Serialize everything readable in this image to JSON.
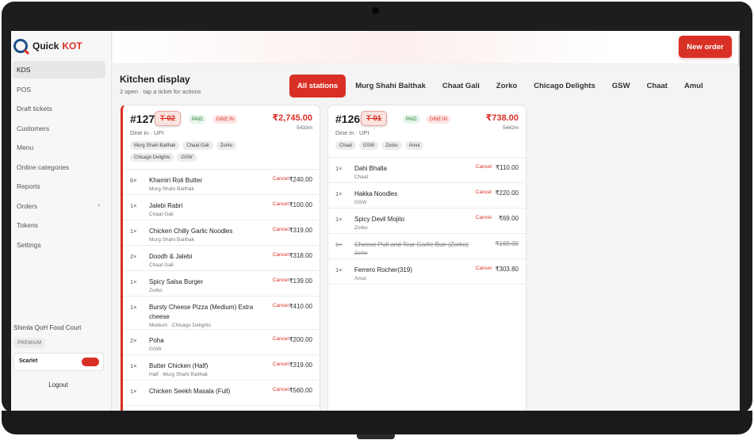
{
  "brand": {
    "name_a": "Quick",
    "name_b": "KOT"
  },
  "sidebar": {
    "items": [
      {
        "label": "KDS",
        "active": true
      },
      {
        "label": "POS"
      },
      {
        "label": "Draft tickets"
      },
      {
        "label": "Customers"
      },
      {
        "label": "Menu"
      },
      {
        "label": "Online categories"
      },
      {
        "label": "Reports"
      },
      {
        "label": "Orders",
        "chevron": "›"
      },
      {
        "label": "Tokens"
      },
      {
        "label": "Settings"
      }
    ],
    "venue": "Shimla QoH Food Court",
    "plan": "PREMIUM",
    "user": "Scarlet",
    "logout": "Logout"
  },
  "header": {
    "new_order": "New order"
  },
  "page": {
    "title": "Kitchen display",
    "subtitle": "2 open · tap a ticket for actions"
  },
  "stations": [
    "All stations",
    "Murg Shahi Baithak",
    "Chaat Gali",
    "Zorko",
    "Chicago Delights",
    "GSW",
    "Chaat",
    "Amul"
  ],
  "tickets": [
    {
      "number": "#127",
      "table": "T-02",
      "paid": "PAID",
      "dine": "DINE IN",
      "total": "₹2,745.00",
      "time": "5433m",
      "meta": "Dine in · UPI",
      "tags": [
        "Murg Shahi Baithak",
        "Chaat Gali",
        "Zorko",
        "Chicago Delights",
        "GSW"
      ],
      "cancel_label": "Cancel",
      "items": [
        {
          "qty": "6×",
          "name": "Khamiri Roti Butter",
          "sub": "Murg Shahi Baithak",
          "price": "₹240.00"
        },
        {
          "qty": "1×",
          "name": "Jalebi Rabri",
          "sub": "Chaat Gali",
          "price": "₹100.00"
        },
        {
          "qty": "1×",
          "name": "Chicken Chilly Garlic Noodles",
          "sub": "Murg Shahi Baithak",
          "price": "₹319.00"
        },
        {
          "qty": "2×",
          "name": "Doodh & Jalebi",
          "sub": "Chaat Gali",
          "price": "₹318.00"
        },
        {
          "qty": "1×",
          "name": "Spicy Salsa Burger",
          "sub": "Zorko",
          "price": "₹139.00"
        },
        {
          "qty": "1×",
          "name": "Bursty Cheese Pizza (Medium) Extra",
          "name2": "cheese",
          "sub": "Medium · Chicago Delights",
          "price": "₹410.00"
        },
        {
          "qty": "2×",
          "name": "Poha",
          "sub": "GSW",
          "price": "₹200.00"
        },
        {
          "qty": "1×",
          "name": "Butter Chicken (Half)",
          "sub": "Half · Murg Shahi Baithak",
          "price": "₹319.00"
        },
        {
          "qty": "1×",
          "name": "Chicken Seekh Masala (Full)",
          "sub": "",
          "price": "₹560.00"
        }
      ]
    },
    {
      "number": "#126",
      "table": "T-01",
      "paid": "PAID",
      "dine": "DINE IN",
      "total": "₹738.00",
      "time": "5442m",
      "meta": "Dine in · UPI",
      "tags": [
        "Chaat",
        "GSW",
        "Zorko",
        "Amul"
      ],
      "cancel_label": "Cancel",
      "items": [
        {
          "qty": "1×",
          "name": "Dahi Bhalla",
          "sub": "Chaat",
          "price": "₹110.00"
        },
        {
          "qty": "1×",
          "name": "Hakka Noodles",
          "sub": "GSW",
          "price": "₹220.00"
        },
        {
          "qty": "1×",
          "name": "Spicy Devil Mojito",
          "sub": "Zorko",
          "price": "₹69.00"
        },
        {
          "qty": "1×",
          "name": "Cheese Pull and Tear Garlic Bun (Zorko)",
          "sub": "Zorko",
          "price": "₹169.00",
          "struck": true
        },
        {
          "qty": "1×",
          "name": "Ferrero Rocher(319)",
          "sub": "Amul",
          "price": "₹303.80"
        }
      ]
    }
  ]
}
